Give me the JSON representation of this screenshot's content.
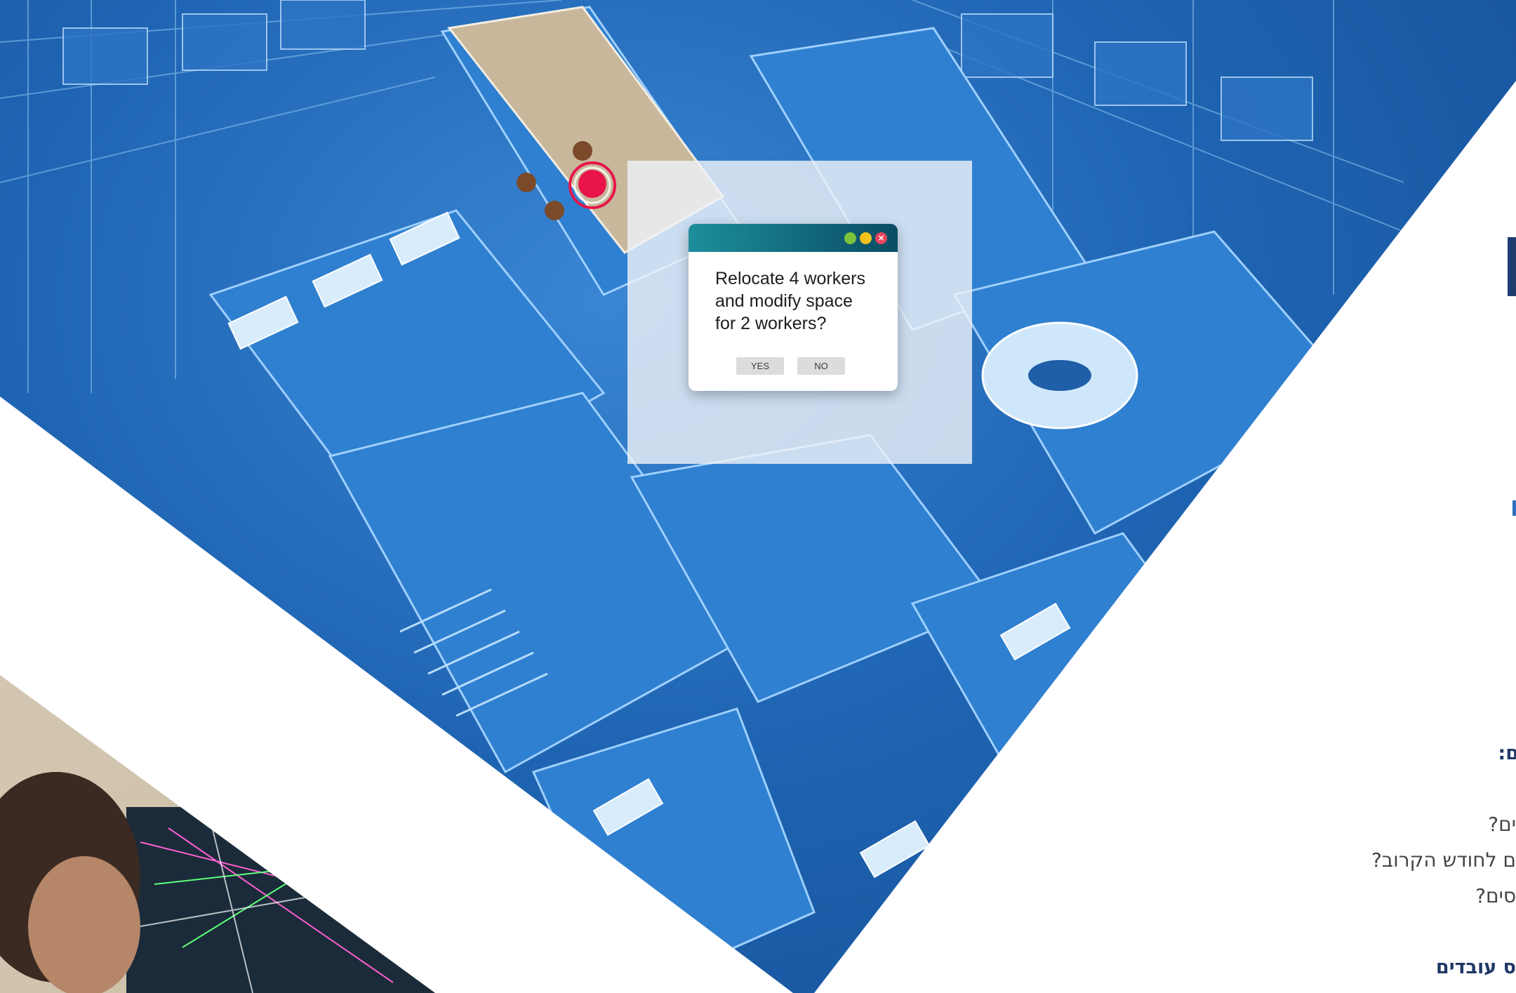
{
  "dialog": {
    "message": "Relocate 4 workers and modify space for 2 workers?",
    "yes_label": "YES",
    "no_label": "NO",
    "titlebar_controls": [
      "minimize-icon",
      "maximize-icon",
      "close-icon"
    ]
  },
  "hero": {
    "description_icon": "office-floorplan-3d",
    "marker_icon": "location-target-icon"
  },
  "right_text": {
    "heading_fragment": "ם:",
    "questions": [
      "ים?",
      "ם לחודש הקרוב?",
      "סים?"
    ],
    "subheading_fragment": "ס עובדים"
  },
  "colors": {
    "hero_blue": "#1f65b3",
    "heading_navy": "#1f3866",
    "dialog_titlebar": "#0f5f75",
    "marker_red": "#e8144a"
  }
}
